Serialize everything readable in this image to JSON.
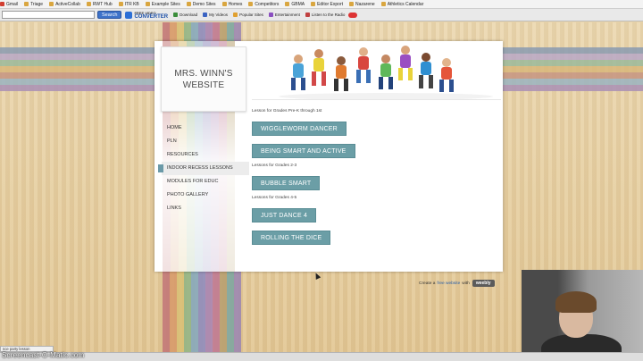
{
  "browser": {
    "bookmarks": [
      "Gmail",
      "Triage",
      "ActiveCollab",
      "RWT Hub",
      "ITR KB",
      "Example Sites",
      "Demo Sites",
      "Homes",
      "Competitors",
      "GBMA",
      "Editor Export",
      "Nazarene",
      "Athletics Calendar"
    ],
    "toolbar": {
      "search_button": "Search",
      "search_value": "",
      "brand_small": "FREE VIDEO",
      "brand_big": "CONVERTER",
      "items": [
        "Download",
        "My Videos",
        "Popular Sites",
        "Entertainment",
        "Listen to the Radio"
      ]
    }
  },
  "site": {
    "title": "MRS. WINN'S WEBSITE",
    "nav": [
      "HOME",
      "PLN",
      "RESOURCES",
      "INDOOR RECESS LESSONS",
      "MODULES FOR EDUC",
      "PHOTO GALLERY",
      "LINKS"
    ],
    "active_nav": "INDOOR RECESS LESSONS",
    "sections": [
      {
        "label": "Lesson for Grades Pre-K through 1st",
        "buttons": [
          "WIGGLEWORM DANCER",
          "BEING SMART AND ACTIVE"
        ]
      },
      {
        "label": "Lessons for Grades 2-3",
        "buttons": [
          "BUBBLE SMART"
        ]
      },
      {
        "label": "Lessons for Grades 4-5",
        "buttons": [
          "JUST DANCE 4",
          "ROLLING THE DICE"
        ]
      }
    ],
    "footer": {
      "prefix": "Create a",
      "link": "free website",
      "suffix": "with",
      "badge": "weebly"
    }
  },
  "taskbar": {
    "tab_label": "nce party lesson"
  },
  "watermark": "Screencast-O-Matic.com",
  "colors": {
    "button": "#6b9ea6",
    "accent": "#6b9aa8"
  }
}
